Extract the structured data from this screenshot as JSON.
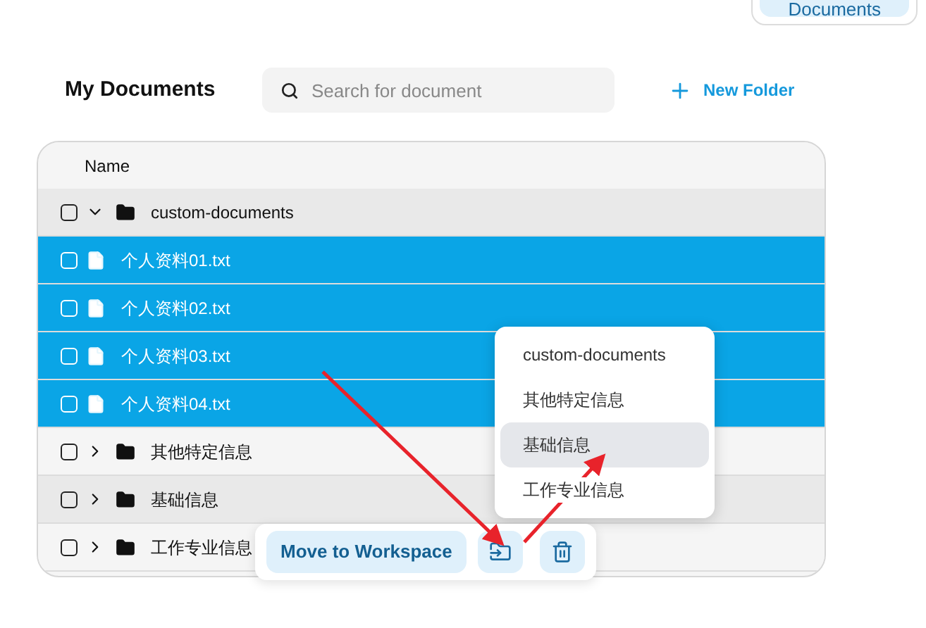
{
  "top_button": {
    "label": "Documents"
  },
  "title": "My Documents",
  "search": {
    "placeholder": "Search for document"
  },
  "new_folder": {
    "label": "New Folder"
  },
  "table": {
    "columns": [
      "Name"
    ],
    "rows": [
      {
        "kind": "folder",
        "name": "custom-documents",
        "expanded": true,
        "checked": false,
        "selected": false,
        "children": [
          {
            "kind": "file",
            "name": "个人资料01.txt",
            "checked": false,
            "selected": true
          },
          {
            "kind": "file",
            "name": "个人资料02.txt",
            "checked": false,
            "selected": true
          },
          {
            "kind": "file",
            "name": "个人资料03.txt",
            "checked": false,
            "selected": true
          },
          {
            "kind": "file",
            "name": "个人资料04.txt",
            "checked": false,
            "selected": true
          }
        ]
      },
      {
        "kind": "folder",
        "name": "其他特定信息",
        "expanded": false,
        "checked": false,
        "selected": false
      },
      {
        "kind": "folder",
        "name": "基础信息",
        "expanded": false,
        "checked": false,
        "selected": false
      },
      {
        "kind": "folder",
        "name": "工作专业信息",
        "expanded": false,
        "checked": false,
        "selected": false
      }
    ]
  },
  "menu": {
    "items": [
      {
        "label": "custom-documents",
        "selected": false
      },
      {
        "label": "其他特定信息",
        "selected": false
      },
      {
        "label": "基础信息",
        "selected": true
      },
      {
        "label": "工作专业信息",
        "selected": false
      }
    ]
  },
  "toolbar": {
    "move_button": "Move to Workspace"
  }
}
